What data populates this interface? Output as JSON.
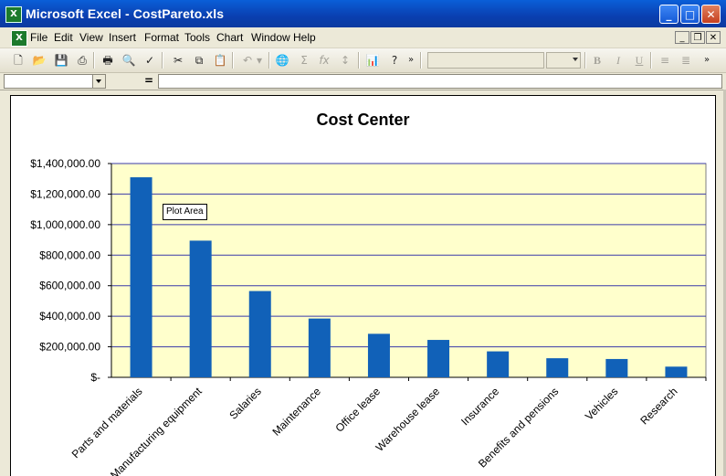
{
  "window": {
    "app_icon": "excel-icon",
    "title": "Microsoft Excel - CostPareto.xls",
    "controls": [
      "minimize-icon",
      "maximize-icon",
      "close-icon"
    ]
  },
  "menubar": {
    "items": [
      "File",
      "Edit",
      "View",
      "Insert",
      "Format",
      "Tools",
      "Chart",
      "Window",
      "Help"
    ],
    "doc_controls": [
      "minimize-icon",
      "restore-icon",
      "close-icon"
    ]
  },
  "toolbar": {
    "icons": [
      "new-icon",
      "open-icon",
      "save-icon",
      "permission-icon",
      "print-icon",
      "print-preview-icon",
      "spelling-icon",
      "cut-icon",
      "copy-icon",
      "paste-icon",
      "undo-icon",
      "hyperlink-icon",
      "autosum-icon",
      "function-icon",
      "sort-icon",
      "chart-wizard-icon",
      "help-icon"
    ],
    "font_name": "",
    "font_size": "",
    "format_labels": [
      "B",
      "I",
      "U"
    ]
  },
  "formula_bar": {
    "name_box": "",
    "equals": "=",
    "content": ""
  },
  "tooltip": "Plot Area",
  "colors": {
    "titlebar": "#0a4fc8",
    "plot_bg": "#ffffcc",
    "bar": "#1161b8",
    "gridline": "#3a3aa8"
  },
  "chart_data": {
    "type": "bar",
    "title": "Cost Center",
    "xlabel": "",
    "ylabel": "",
    "categories": [
      "Parts and materials",
      "Manufacturing equipment",
      "Salaries",
      "Maintenance",
      "Office lease",
      "Warehouse lease",
      "Insurance",
      "Benefits and pensions",
      "Vehicles",
      "Research"
    ],
    "values": [
      1310000,
      895000,
      565000,
      385000,
      285000,
      245000,
      170000,
      125000,
      120000,
      70000
    ],
    "ylim": [
      0,
      1400000
    ],
    "yticks": [
      0,
      200000,
      400000,
      600000,
      800000,
      1000000,
      1200000,
      1400000
    ],
    "ytick_labels": [
      "$-",
      "$200,000.00",
      "$400,000.00",
      "$600,000.00",
      "$800,000.00",
      "$1,000,000.00",
      "$1,200,000.00",
      "$1,400,000.00"
    ],
    "grid": true,
    "legend": "none"
  }
}
